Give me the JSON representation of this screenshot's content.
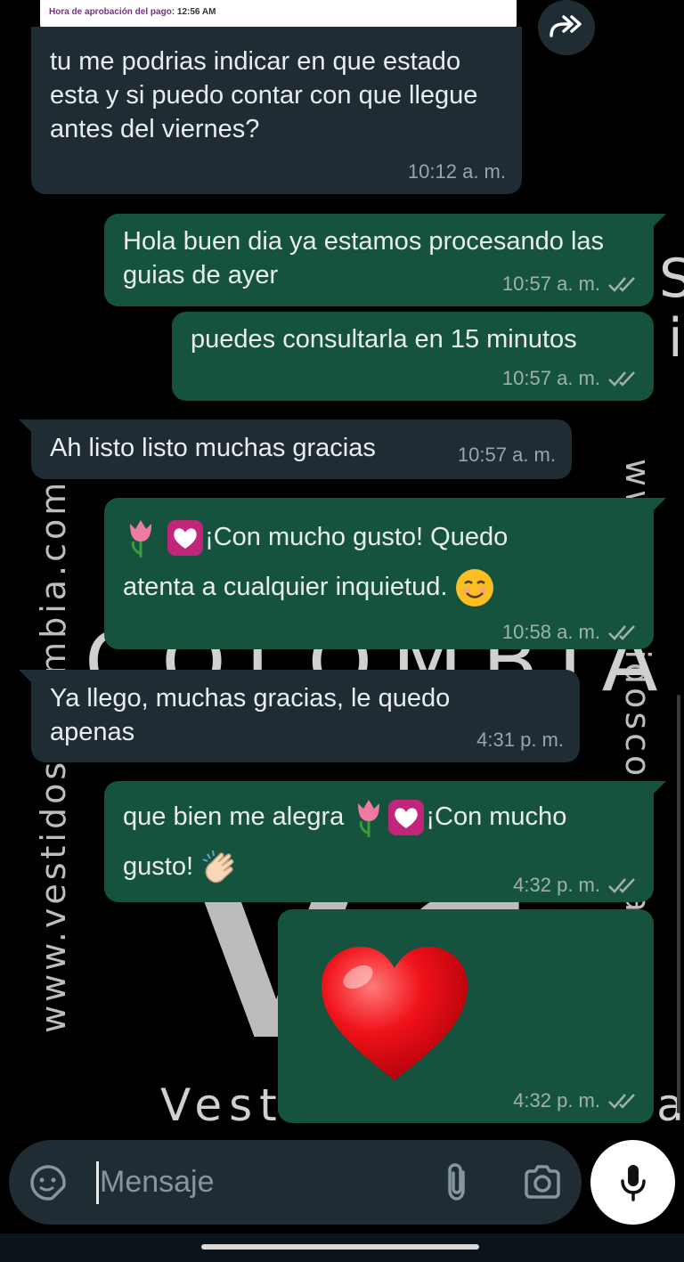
{
  "quoted": {
    "label": "Hora de aprobación del pago:",
    "time": "12:56 AM"
  },
  "wallpaper": {
    "left_text": "www.vestidoscolombia.com",
    "right_text": "www.vestidoscolombia.com",
    "brand": "COLOMBIA",
    "footer": "Vestidos Colombia",
    "logo": "VC"
  },
  "messages": [
    {
      "dir": "in",
      "text": "tu me podrias indicar en que estado esta y si puedo contar con que llegue antes del viernes?",
      "time": "10:12 a. m."
    },
    {
      "dir": "out",
      "text": "Hola buen dia ya estamos procesando las guias de ayer",
      "time": "10:57 a. m."
    },
    {
      "dir": "out",
      "text": "puedes consultarla en 15 minutos",
      "time": "10:57 a. m."
    },
    {
      "dir": "in",
      "text": "Ah listo listo muchas gracias",
      "time": "10:57 a. m."
    },
    {
      "dir": "out",
      "text_a": "¡Con mucho gusto!  Quedo",
      "text_b": "atenta a cualquier inquietud.",
      "time": "10:58 a. m."
    },
    {
      "dir": "in",
      "text": "Ya llego, muchas gracias, le quedo apenas",
      "time": "4:31 p. m."
    },
    {
      "dir": "out",
      "text_a": "que bien me alegra",
      "text_b": "¡Con mucho",
      "text_c": "gusto!",
      "time": "4:32 p. m."
    },
    {
      "dir": "out",
      "emoji": "heart",
      "time": "4:32 p. m."
    }
  ],
  "input": {
    "placeholder": "Mensaje"
  },
  "icons": {
    "forward": "forward-icon",
    "sticker": "sticker-icon",
    "attach": "paperclip-icon",
    "camera": "camera-icon",
    "mic": "mic-icon",
    "read": "double-check-icon"
  },
  "colors": {
    "outgoing": "#15533f",
    "incoming": "#1f2c33",
    "background": "#000000"
  }
}
